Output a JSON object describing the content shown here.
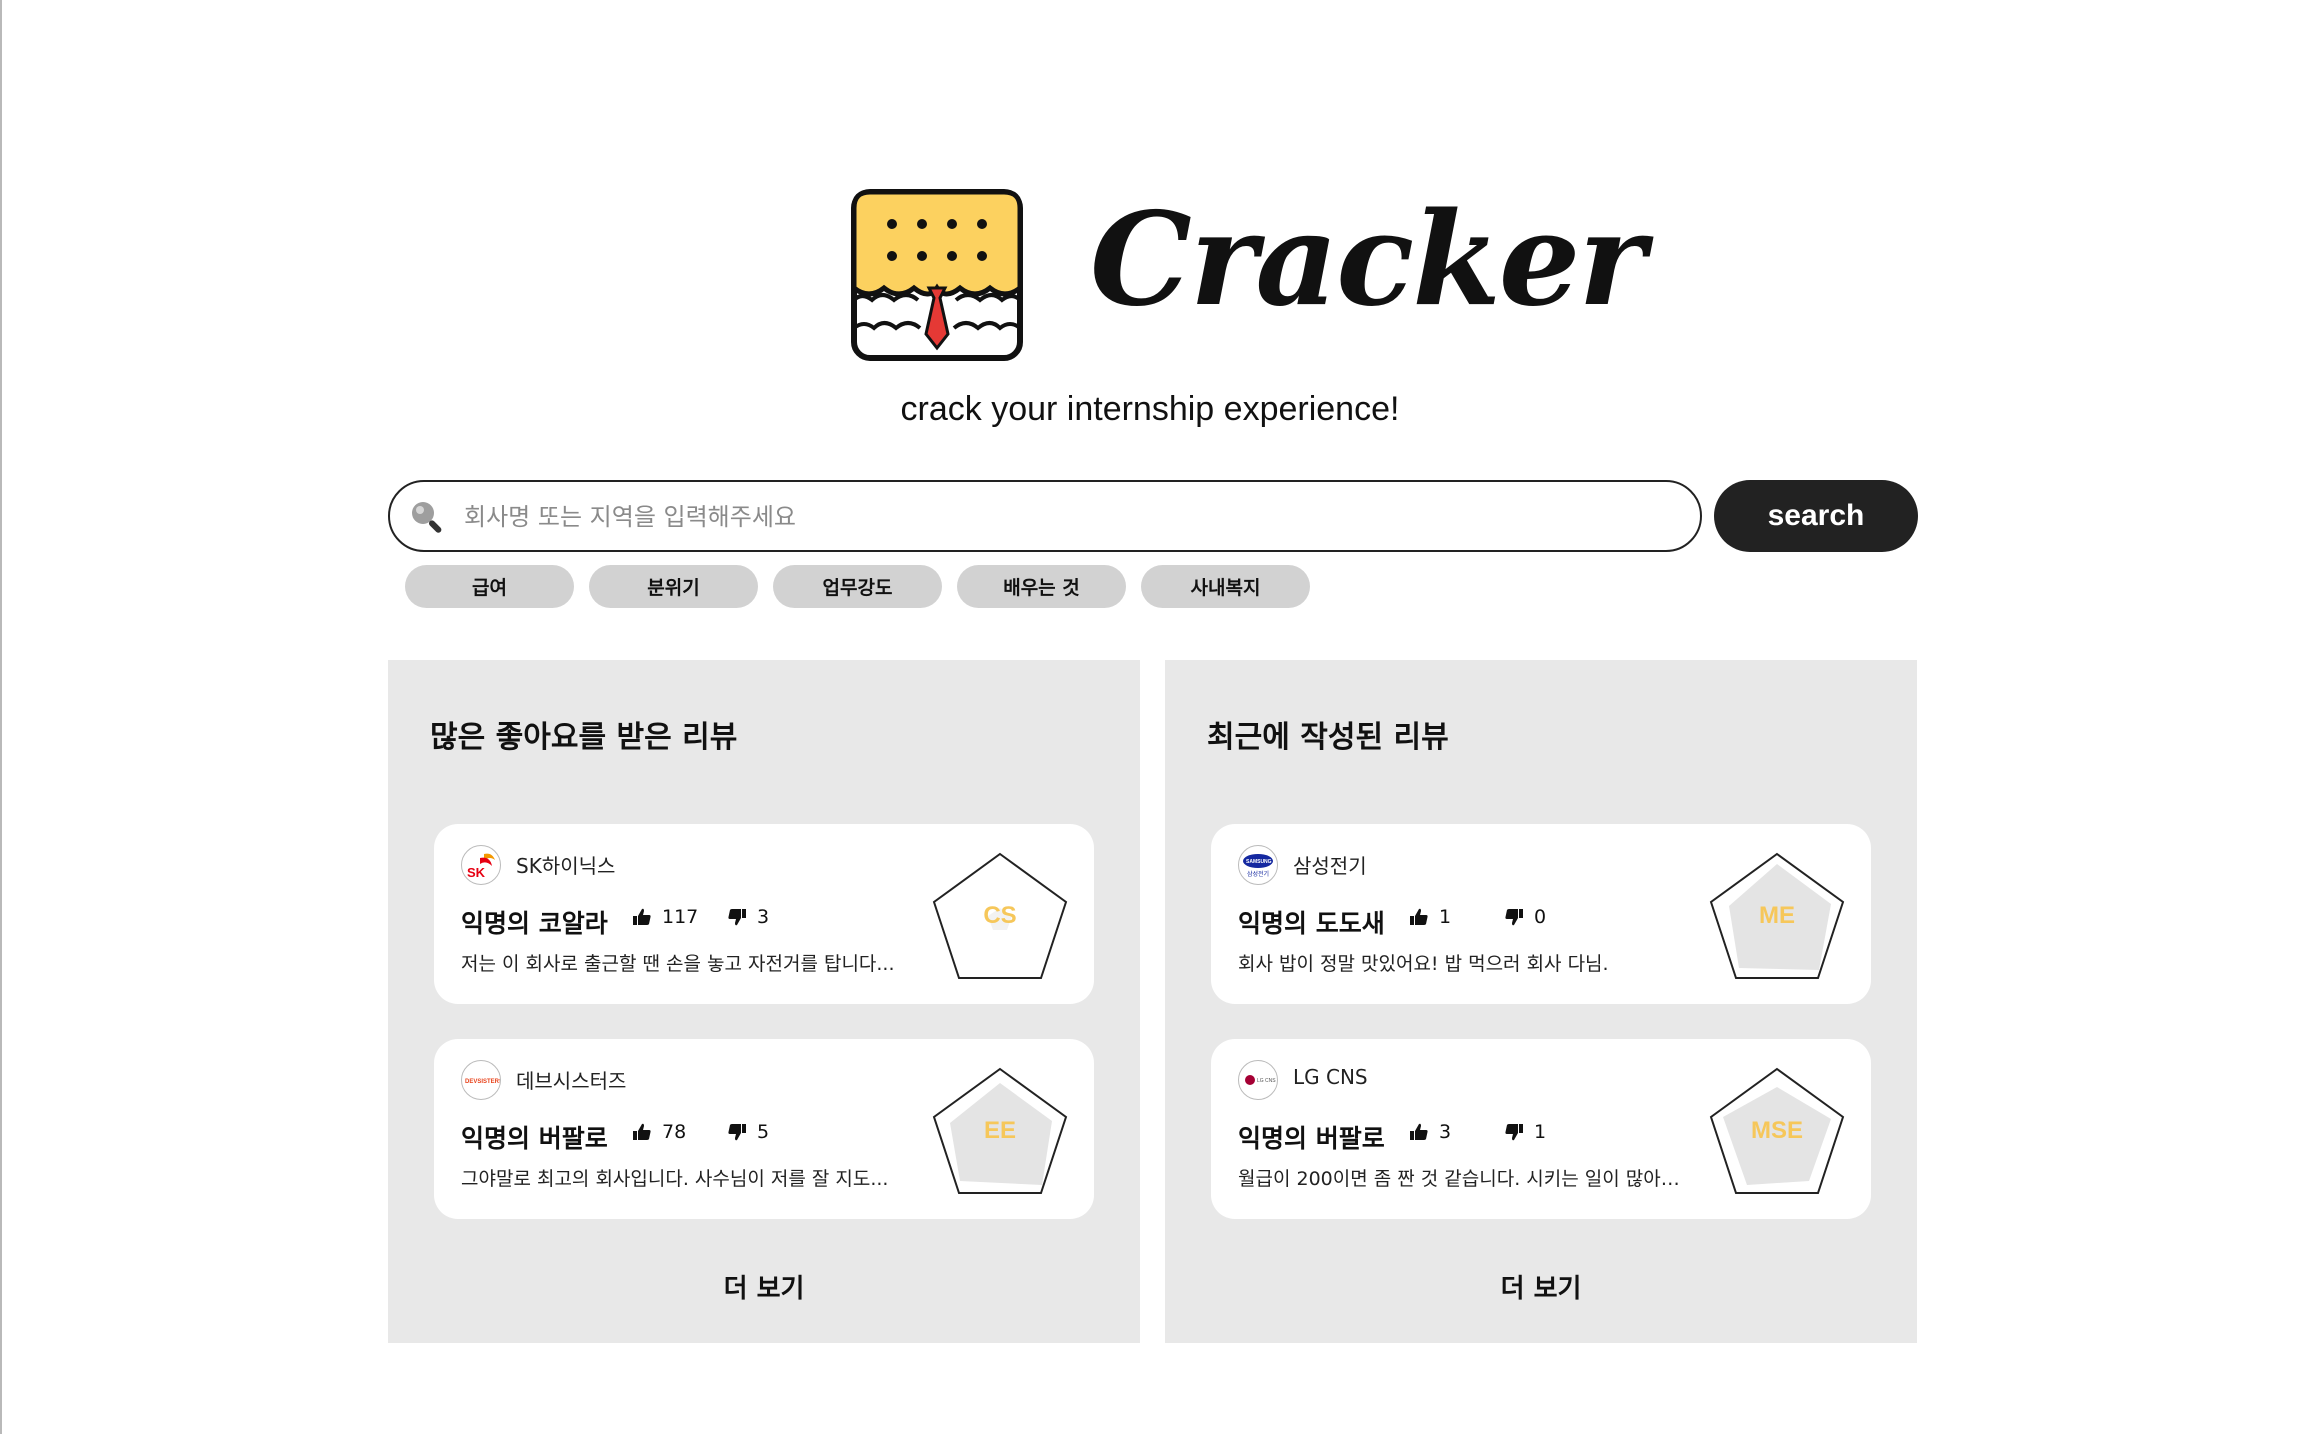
{
  "brand": {
    "name": "Cracker",
    "tagline": "crack your internship experience!"
  },
  "search": {
    "placeholder": "회사명 또는 지역을 입력해주세요",
    "value": "",
    "button_label": "search"
  },
  "filters": [
    "급여",
    "분위기",
    "업무강도",
    "배우는 것",
    "사내복지"
  ],
  "panels": [
    {
      "title": "많은 좋아요를 받은 리뷰",
      "more_label": "더 보기",
      "reviews": [
        {
          "company": "SK하이닉스",
          "title": "익명의 코알라",
          "likes": "117",
          "dislikes": "3",
          "excerpt": "저는 이 회사로 출근할 땐 손을 놓고 자전거를 탑니다...",
          "major": "CS",
          "logo_icon": "sk-hynix-logo-icon"
        },
        {
          "company": "데브시스터즈",
          "title": "익명의 버팔로",
          "likes": "78",
          "dislikes": "5",
          "excerpt": "그야말로 최고의 회사입니다. 사수님이 저를 잘 지도...",
          "major": "EE",
          "logo_icon": "devsisters-logo-icon"
        }
      ]
    },
    {
      "title": "최근에 작성된 리뷰",
      "more_label": "더 보기",
      "reviews": [
        {
          "company": "삼성전기",
          "title": "익명의 도도새",
          "likes": "1",
          "dislikes": "0",
          "excerpt": "회사 밥이 정말 맛있어요! 밥 먹으러 회사 다님.",
          "major": "ME",
          "logo_icon": "samsung-logo-icon"
        },
        {
          "company": "LG CNS",
          "title": "익명의 버팔로",
          "likes": "3",
          "dislikes": "1",
          "excerpt": "월급이 200이면 좀 짠 것 같습니다. 시키는 일이 많아요...",
          "major": "MSE",
          "logo_icon": "lg-logo-icon"
        }
      ]
    }
  ],
  "colors": {
    "accent": "#222222",
    "chip": "#d2d2d2",
    "panel": "#e8e8e8",
    "cracker": "#fcd15f",
    "major_label": "#f6c75a",
    "tie": "#e53935"
  }
}
